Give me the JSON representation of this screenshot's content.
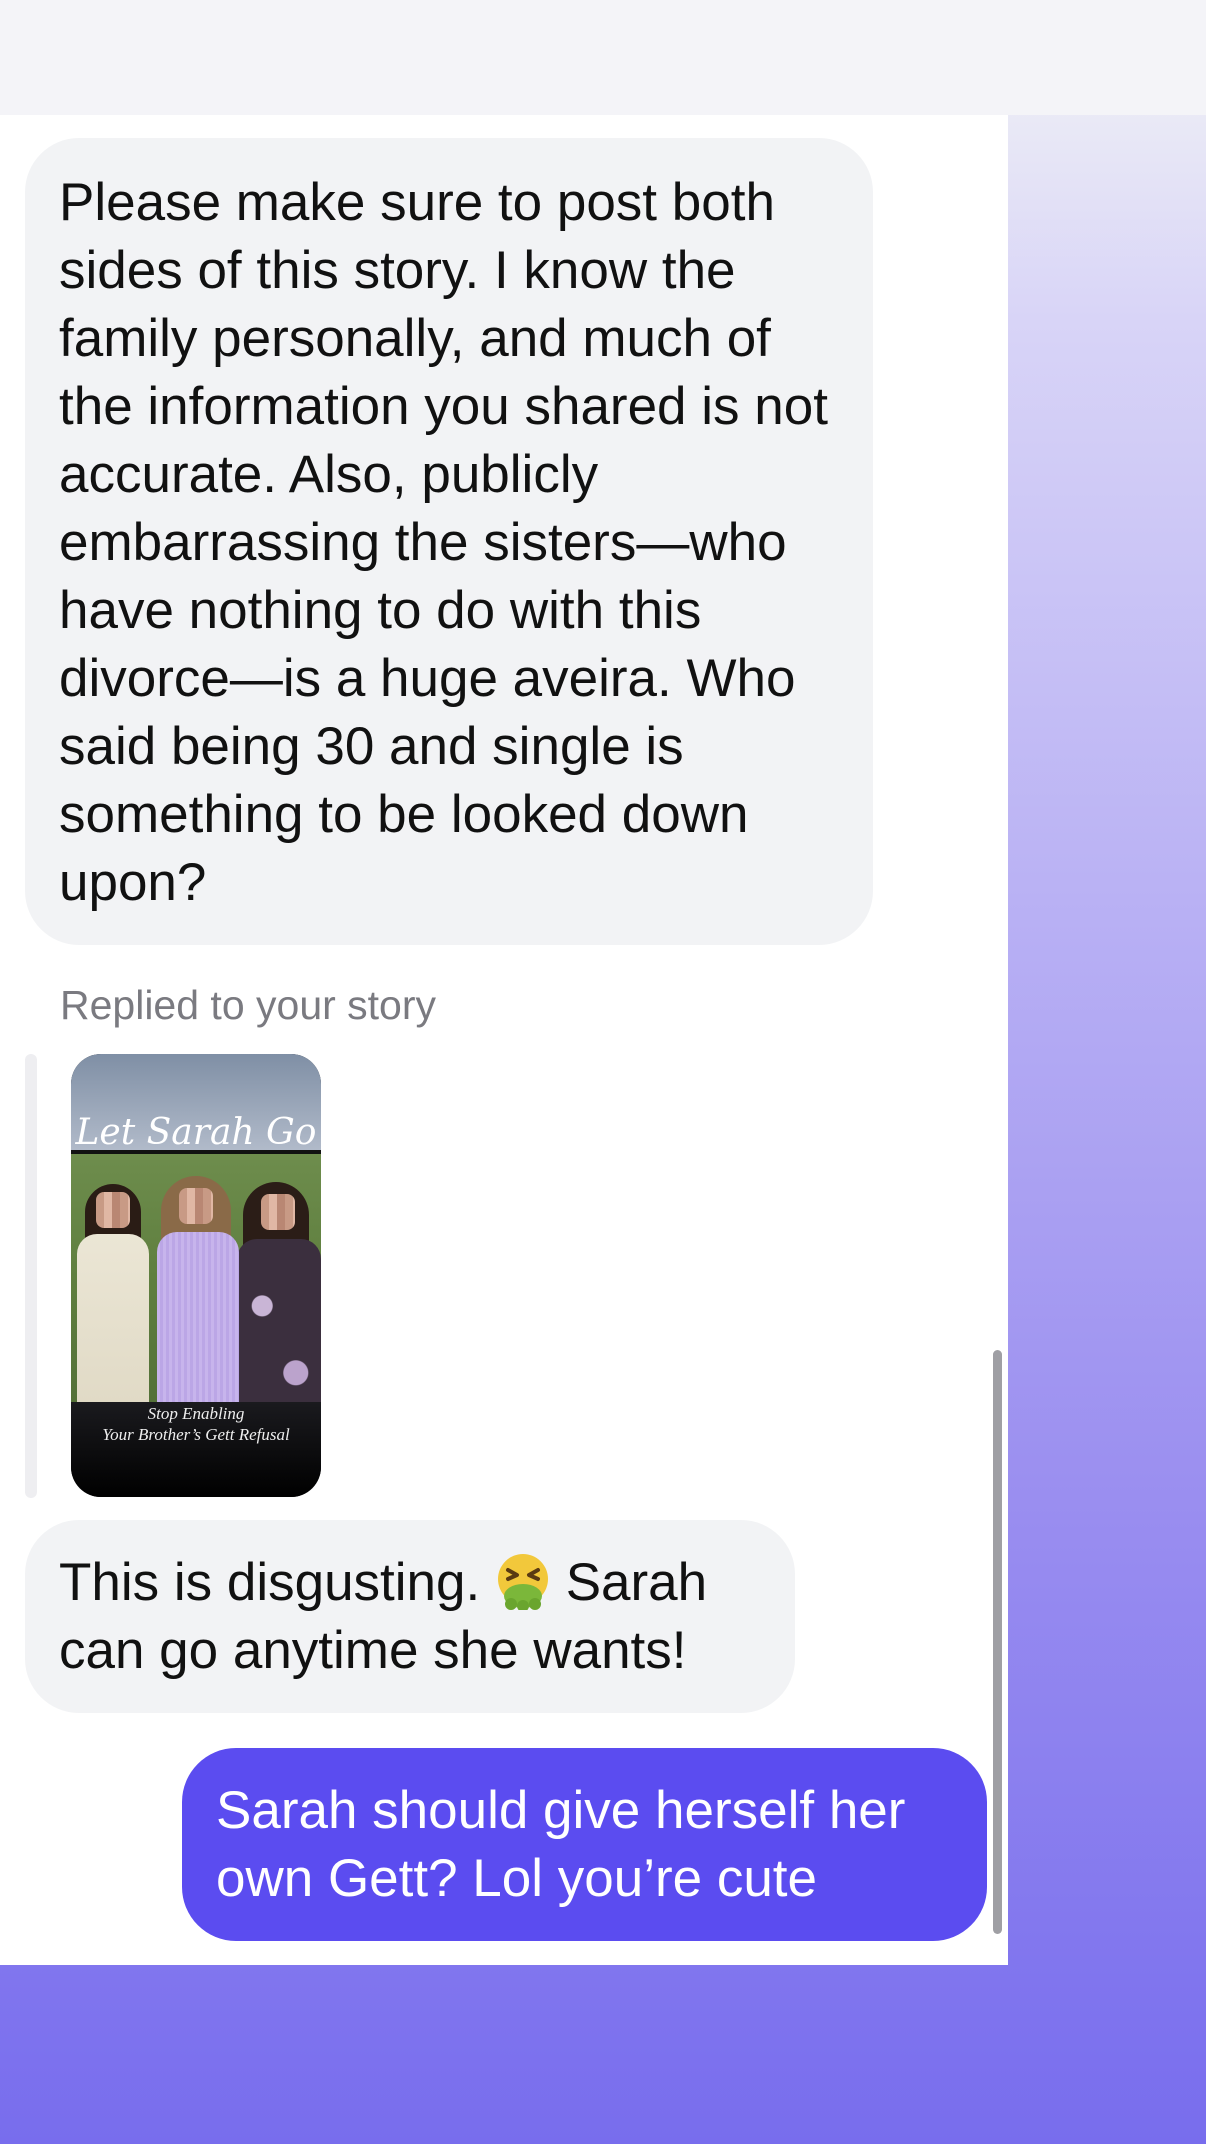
{
  "messages": [
    {
      "id": "m1",
      "direction": "incoming",
      "text": "Please make sure to post both sides of this story. I know the family personally, and much of the information you shared is not accurate. Also, publicly embarrassing the sisters—who have nothing to do with this divorce—is a huge aveira. Who said being 30 and single is something to be looked down upon?"
    },
    {
      "id": "m2",
      "direction": "incoming",
      "reply_label": "Replied to your story",
      "story": {
        "title": "Let Sarah Go",
        "caption_line1": "Stop Enabling",
        "caption_line2": "Your Brother’s Gett Refusal"
      },
      "text_before_emoji": "This is disgusting. ",
      "emoji": "nauseated-face-emoji",
      "text_after_emoji": " Sarah can go anytime she wants!"
    },
    {
      "id": "m3",
      "direction": "outgoing",
      "text": "Sarah should give herself her own Gett? Lol you’re cute"
    }
  ],
  "colors": {
    "incoming_bubble": "#f2f3f5",
    "outgoing_bubble": "#5b4cf0",
    "label_gray": "#7a7a80",
    "background_gradient_end": "#786ded"
  }
}
